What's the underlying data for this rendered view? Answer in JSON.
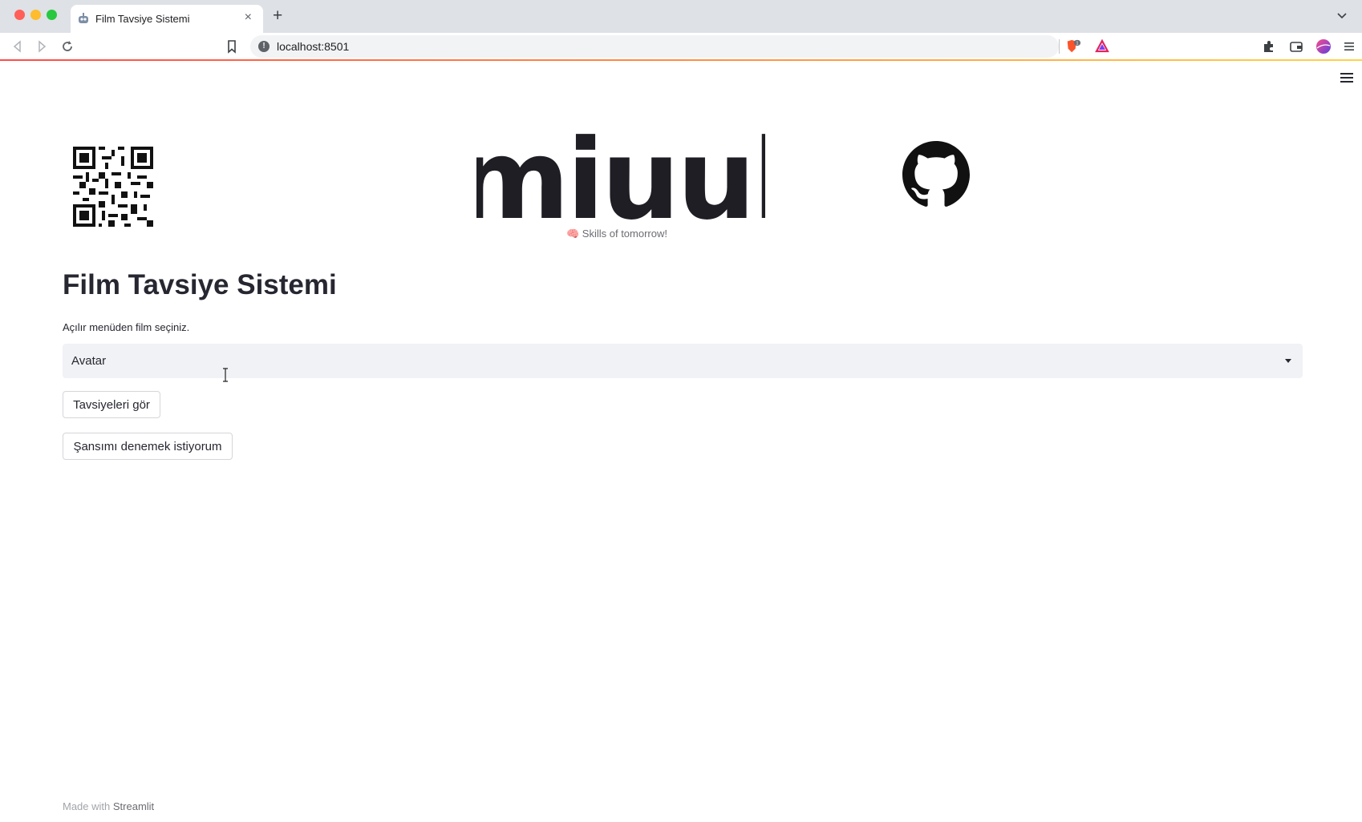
{
  "browser": {
    "tab_title": "Film Tavsiye Sistemi",
    "tab_close": "×",
    "new_tab": "+",
    "url": "localhost:8501",
    "shield_count": "1",
    "icons": [
      "back-icon",
      "forward-icon",
      "reload-icon",
      "bookmark-icon",
      "site-info-icon",
      "brave-shield-icon",
      "brave-rewards-icon",
      "extensions-icon",
      "wallet-icon",
      "profile-avatar-icon",
      "browser-menu-icon",
      "tabs-dropdown-icon"
    ]
  },
  "header": {
    "logo_text": "miuul",
    "tagline": "🧠 Skills of tomorrow!"
  },
  "main": {
    "title": "Film Tavsiye Sistemi",
    "select_label": "Açılır menüden film seçiniz.",
    "select_value": "Avatar",
    "button_recommend": "Tavsiyeleri gör",
    "button_lucky": "Şansımı denemek istiyorum"
  },
  "footer": {
    "made_with": "Made with",
    "brand": "Streamlit"
  },
  "colors": {
    "accent_gradient_start": "#ff4b4b",
    "accent_gradient_end": "#ffd24a",
    "select_bg": "#f0f2f6",
    "text": "#262730"
  }
}
